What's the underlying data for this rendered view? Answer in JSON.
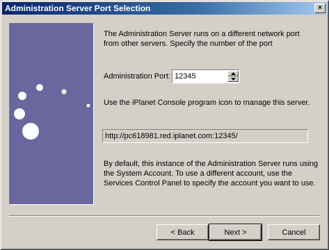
{
  "window": {
    "title": "Administration Server Port Selection",
    "close_glyph": "×"
  },
  "content": {
    "intro": "The Administration Server runs on a different network port from other servers. Specify the number of the port",
    "port_label": "Administration Port:",
    "port_value": "12345",
    "console_note": "Use the iPlanet Console program icon to manage this server.",
    "url": "http://pc618981.red.iplanet.com:12345/",
    "account_note": "By default, this instance of the Administration Server runs using the System Account. To use a different account, use the Services Control Panel to specify the account you want to use."
  },
  "buttons": {
    "back": "< Back",
    "next": "Next >",
    "cancel": "Cancel"
  },
  "icons": {
    "close": "close-icon",
    "spin_up": "triangle-up-icon",
    "spin_down": "triangle-down-icon"
  },
  "colors": {
    "title_bar_start": "#0a246a",
    "title_bar_end": "#a6caf0",
    "banner": "#6a669e",
    "dialog_face": "#d4d0c8"
  }
}
